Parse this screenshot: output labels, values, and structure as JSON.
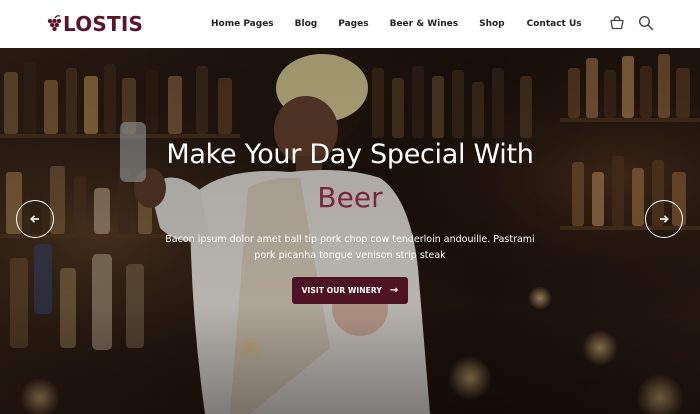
{
  "brand": {
    "name": "LOSTIS",
    "color": "#5b1428"
  },
  "nav": {
    "items": [
      {
        "label": "Home Pages"
      },
      {
        "label": "Blog"
      },
      {
        "label": "Pages"
      },
      {
        "label": "Beer & Wines"
      },
      {
        "label": "Shop"
      },
      {
        "label": "Contact Us"
      }
    ]
  },
  "header_icons": {
    "cart": "cart-icon",
    "search": "search-icon"
  },
  "hero": {
    "title": "Make Your Day Special With",
    "highlight": "Beer",
    "description_line1": "Bacon ipsum dolor amet ball tip pork chop cow tenderloin andouille. Pastrami",
    "description_line2": "pork picanha tongue venison strip steak",
    "cta_label": "VISIT OUR WINERY",
    "cta_arrow": "→",
    "accent_color": "#4e1426",
    "highlight_color": "#7a2440"
  },
  "slider": {
    "prev_icon": "arrow-left-icon",
    "next_icon": "arrow-right-icon"
  }
}
